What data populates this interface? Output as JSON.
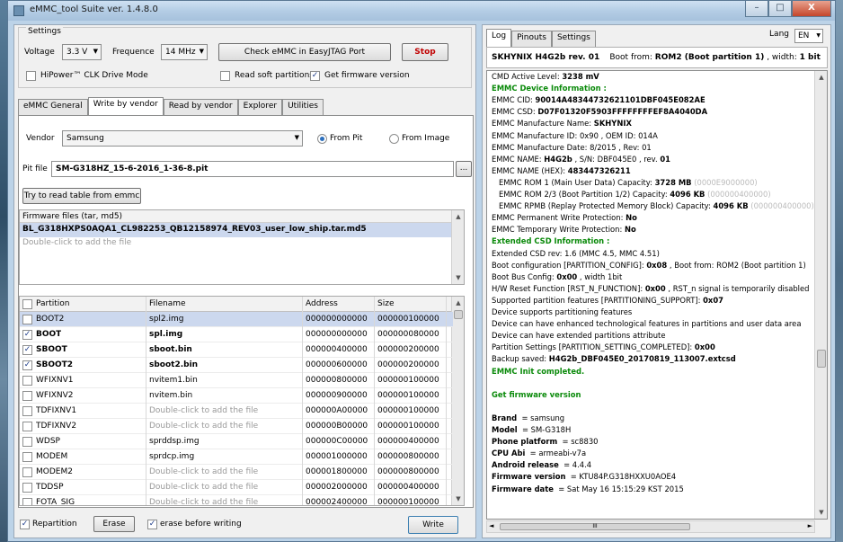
{
  "window": {
    "title": "eMMC_tool Suite  ver. 1.4.8.0",
    "min": "–",
    "max": "□",
    "close": "X"
  },
  "settings": {
    "label": "Settings",
    "voltage_label": "Voltage",
    "voltage_value": "3.3 V",
    "frequence_label": "Frequence",
    "frequence_value": "14 MHz",
    "check_button": "Check eMMC in EasyJTAG Port",
    "stop_button": "Stop",
    "hipower_label": "HiPower™ CLK Drive Mode",
    "hipower_checked": false,
    "read_soft_label": "Read soft partitions",
    "read_soft_checked": false,
    "get_fw_label": "Get firmware version",
    "get_fw_checked": true
  },
  "tabs": [
    "eMMC General",
    "Write by vendor",
    "Read by vendor",
    "Explorer",
    "Utilities"
  ],
  "active_tab": "Write by vendor",
  "write": {
    "vendor_label": "Vendor",
    "vendor_value": "Samsung",
    "from_pit": "From Pit",
    "from_image": "From Image",
    "pit_label": "Pit file",
    "pit_value": "SM-G318HZ_15-6-2016_1-36-8.pit",
    "browse": "...",
    "try_button": "Try to read table from emmc",
    "fw_header": "Firmware files (tar, md5)",
    "fw_file": "BL_G318HXPS0AQA1_CL982253_QB12158974_REV03_user_low_ship.tar.md5",
    "fw_hint": "Double-click to add the file"
  },
  "partitions": {
    "headers": [
      "Partition",
      "Filename",
      "Address",
      "Size"
    ],
    "rows": [
      {
        "checked": false,
        "name": "BOOT2",
        "file": "spl2.img",
        "addr": "000000000000",
        "size": "000000100000",
        "bold": false,
        "hint": false
      },
      {
        "checked": true,
        "name": "BOOT",
        "file": "spl.img",
        "addr": "000000000000",
        "size": "000000080000",
        "bold": true,
        "hint": false
      },
      {
        "checked": true,
        "name": "SBOOT",
        "file": "sboot.bin",
        "addr": "000000400000",
        "size": "000000200000",
        "bold": true,
        "hint": false
      },
      {
        "checked": true,
        "name": "SBOOT2",
        "file": "sboot2.bin",
        "addr": "000000600000",
        "size": "000000200000",
        "bold": true,
        "hint": false
      },
      {
        "checked": false,
        "name": "WFIXNV1",
        "file": "nvitem1.bin",
        "addr": "000000800000",
        "size": "000000100000",
        "bold": false,
        "hint": false
      },
      {
        "checked": false,
        "name": "WFIXNV2",
        "file": "nvitem.bin",
        "addr": "000000900000",
        "size": "000000100000",
        "bold": false,
        "hint": false
      },
      {
        "checked": false,
        "name": "TDFIXNV1",
        "file": "Double-click to add the file",
        "addr": "000000A00000",
        "size": "000000100000",
        "bold": false,
        "hint": true
      },
      {
        "checked": false,
        "name": "TDFIXNV2",
        "file": "Double-click to add the file",
        "addr": "000000B00000",
        "size": "000000100000",
        "bold": false,
        "hint": true
      },
      {
        "checked": false,
        "name": "WDSP",
        "file": "sprddsp.img",
        "addr": "000000C00000",
        "size": "000000400000",
        "bold": false,
        "hint": false
      },
      {
        "checked": false,
        "name": "MODEM",
        "file": "sprdcp.img",
        "addr": "000001000000",
        "size": "000000800000",
        "bold": false,
        "hint": false
      },
      {
        "checked": false,
        "name": "MODEM2",
        "file": "Double-click to add the file",
        "addr": "000001800000",
        "size": "000000800000",
        "bold": false,
        "hint": true
      },
      {
        "checked": false,
        "name": "TDDSP",
        "file": "Double-click to add the file",
        "addr": "000002000000",
        "size": "000000400000",
        "bold": false,
        "hint": true
      },
      {
        "checked": false,
        "name": "FOTA_SIG",
        "file": "Double-click to add the file",
        "addr": "000002400000",
        "size": "000000100000",
        "bold": false,
        "hint": true
      }
    ]
  },
  "bottom": {
    "repartition_label": "Repartition",
    "repartition_checked": true,
    "erase_button": "Erase",
    "erase_before_label": "erase before writing",
    "erase_before_checked": true,
    "write_button": "Write"
  },
  "right": {
    "tabs": [
      "Log",
      "Pinouts",
      "Settings"
    ],
    "lang_label": "Lang",
    "lang_value": "EN",
    "status_text": "SKHYNIX  H4G2b  rev. 01",
    "status_boot": "Boot from: ",
    "status_boot_val": "ROM2 (Boot partition 1)",
    "status_width": " , width: ",
    "status_width_val": "1 bit",
    "log": [
      {
        "a": "CMD Active Level: ",
        "b": "3238  mV",
        "cls": ""
      },
      {
        "a": "EMMC Device Information :",
        "b": "",
        "cls": "g"
      },
      {
        "a": "EMMC CID: ",
        "b": "90014A48344732621101DBF045E082AE",
        "cls": ""
      },
      {
        "a": "EMMC CSD: ",
        "b": "D07F01320F5903FFFFFFFFEF8A4040DA",
        "cls": ""
      },
      {
        "a": "EMMC Manufacture Name: ",
        "b": "SKHYNIX",
        "cls": ""
      },
      {
        "a": "EMMC Manufacture ID: 0x90 , OEM ID: 014A",
        "b": "",
        "cls": ""
      },
      {
        "a": "EMMC Manufacture Date: 8/2015 , Rev: 01",
        "b": "",
        "cls": ""
      },
      {
        "a": "EMMC NAME: ",
        "b": "H4G2b",
        "c": " , S/N: DBF045E0 , rev. ",
        "d": "01",
        "cls": ""
      },
      {
        "a": "EMMC NAME (HEX): ",
        "b": "483447326211",
        "cls": ""
      },
      {
        "a": "   EMMC ROM 1 (Main User Data) Capacity: ",
        "b": "3728 MB",
        "dim": " (0000E9000000)",
        "cls": ""
      },
      {
        "a": "   EMMC ROM 2/3 (Boot Partition 1/2) Capacity: ",
        "b": "4096 KB",
        "dim": " (000000400000)",
        "cls": ""
      },
      {
        "a": "   EMMC RPMB (Replay Protected Memory Block) Capacity: ",
        "b": "4096 KB",
        "dim": " (000000400000)",
        "cls": ""
      },
      {
        "a": "EMMC Permanent Write Protection: ",
        "b": "No",
        "cls": ""
      },
      {
        "a": "EMMC Temporary Write Protection: ",
        "b": "No",
        "cls": ""
      },
      {
        "a": "Extended CSD Information :",
        "b": "",
        "cls": "g"
      },
      {
        "a": "Extended CSD rev: 1.6 (MMC 4.5, MMC 4.51)",
        "b": "",
        "cls": ""
      },
      {
        "a": "Boot configuration [PARTITION_CONFIG]: ",
        "b": "0x08",
        "c": " , Boot from: ROM2 (Boot partition 1)",
        "cls": ""
      },
      {
        "a": "Boot Bus Config: ",
        "b": "0x00",
        "c": " , width 1bit",
        "cls": ""
      },
      {
        "a": "H/W Reset Function [RST_N_FUNCTION]: ",
        "b": "0x00",
        "c": " , RST_n signal is temporarily disabled",
        "cls": ""
      },
      {
        "a": "Supported partition features [PARTITIONING_SUPPORT]: ",
        "b": "0x07",
        "cls": ""
      },
      {
        "a": "Device supports partitioning features",
        "b": "",
        "cls": ""
      },
      {
        "a": "Device can have enhanced technological features in partitions and user data area",
        "b": "",
        "cls": ""
      },
      {
        "a": "Device can have extended partitions attribute",
        "b": "",
        "cls": ""
      },
      {
        "a": "Partition Settings [PARTITION_SETTING_COMPLETED]: ",
        "b": "0x00",
        "cls": ""
      },
      {
        "a": "Backup saved: ",
        "b": "H4G2b_DBF045E0_20170819_113007.extcsd",
        "cls": ""
      },
      {
        "a": "EMMC Init completed.",
        "b": "",
        "cls": "g"
      },
      {
        "a": "",
        "b": "",
        "cls": ""
      },
      {
        "a": "Get firmware version",
        "b": "",
        "cls": "g"
      },
      {
        "a": "",
        "b": "",
        "cls": ""
      },
      {
        "a": "",
        "b": "Brand",
        "c": "  = samsung",
        "cls": ""
      },
      {
        "a": "",
        "b": "Model",
        "c": "  = SM-G318H",
        "cls": ""
      },
      {
        "a": "",
        "b": "Phone platform",
        "c": "  = sc8830",
        "cls": ""
      },
      {
        "a": "",
        "b": "CPU Abi",
        "c": "  = armeabi-v7a",
        "cls": ""
      },
      {
        "a": "",
        "b": "Android release",
        "c": "  = 4.4.4",
        "cls": ""
      },
      {
        "a": "",
        "b": "Firmware version",
        "c": "  = KTU84P.G318HXXU0AOE4",
        "cls": ""
      },
      {
        "a": "",
        "b": "Firmware date",
        "c": "  = Sat May 16 15:15:29 KST 2015",
        "cls": ""
      }
    ],
    "hscroll_grip": "III"
  }
}
